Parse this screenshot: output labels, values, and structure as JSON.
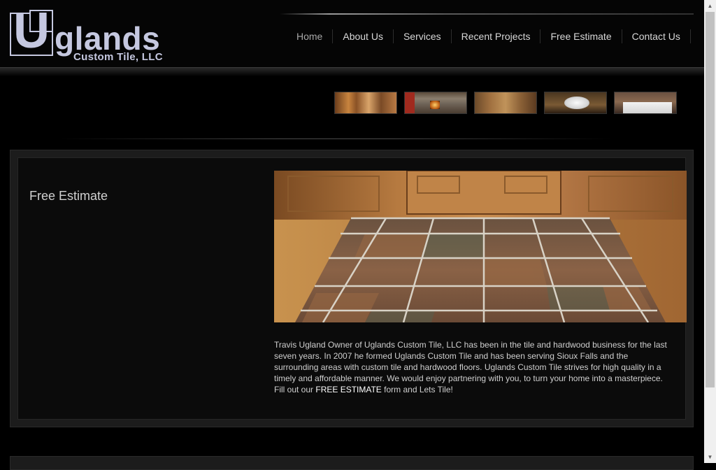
{
  "logo": {
    "letter": "U",
    "rest": "glands",
    "subtitle": "Custom Tile, LLC"
  },
  "nav": {
    "items": [
      "Home",
      "About Us",
      "Services",
      "Recent Projects",
      "Free Estimate",
      "Contact Us"
    ],
    "active": "Home"
  },
  "thumbnails": [
    "wood-floor-thumb",
    "fireplace-thumb",
    "kitchen-backsplash-thumb",
    "bathroom-sink-thumb",
    "bathtub-thumb"
  ],
  "main": {
    "title": "Free Estimate",
    "body": "Travis Ugland Owner of Uglands Custom Tile, LLC has been in the tile and hardwood business for the last seven years.  In 2007 he formed Uglands Custom Tile and has been serving Sioux Falls and the surrounding areas with custom tile and hardwood floors.  Uglands Custom Tile strives for high quality in a timely and affordable manner.  We would enjoy partnering with you, to turn your home into a masterpiece.  Fill out our ",
    "link": "FREE ESTIMATE",
    "body_end": " form and Lets Tile!"
  },
  "colors": {
    "background": "#000000",
    "logo": "#c5c8e0",
    "panel": "#1c1c1c",
    "text": "#cfcfcf"
  }
}
